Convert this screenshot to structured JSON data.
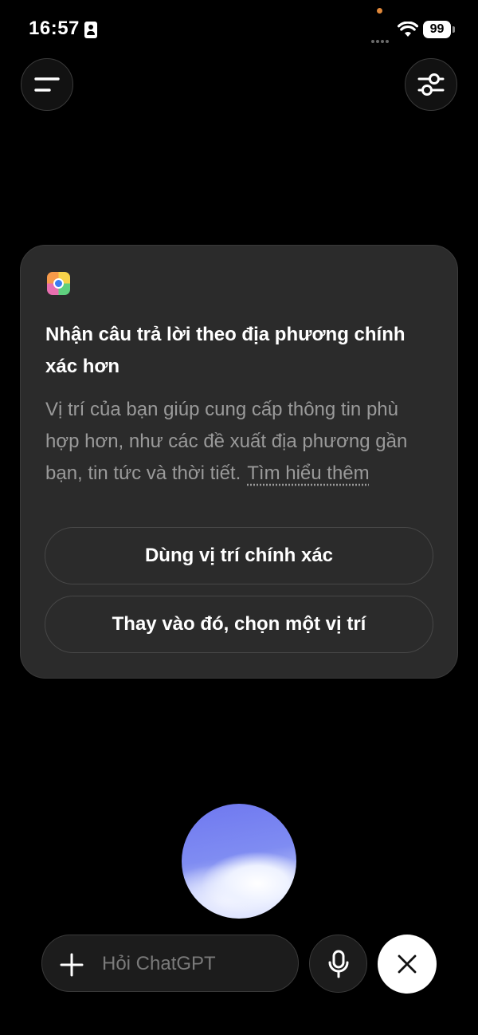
{
  "status_bar": {
    "time": "16:57",
    "battery": "99",
    "icons": [
      "person-id-icon",
      "signal-icon",
      "wifi-icon",
      "battery-icon"
    ]
  },
  "header": {
    "menu_icon": "menu-icon",
    "settings_icon": "sliders-icon"
  },
  "location_card": {
    "icon": "location-app-icon",
    "title": "Nhận câu trả lời theo địa phương chính xác hơn",
    "body": "Vị trí của bạn giúp cung cấp thông tin phù hợp hơn, như các đề xuất địa phương gần bạn, tin tức và thời tiết.",
    "learn_more": "Tìm hiểu thêm",
    "primary_button": "Dùng vị trí chính xác",
    "secondary_button": "Thay vào đó, chọn một vị trí"
  },
  "composer": {
    "placeholder": "Hỏi ChatGPT",
    "plus_icon": "plus-icon",
    "mic_icon": "microphone-icon",
    "close_icon": "close-icon"
  },
  "colors": {
    "background": "#000000",
    "card": "#2b2b2b",
    "muted_text": "#9a9a9a",
    "orb": "#7f8cf2"
  }
}
